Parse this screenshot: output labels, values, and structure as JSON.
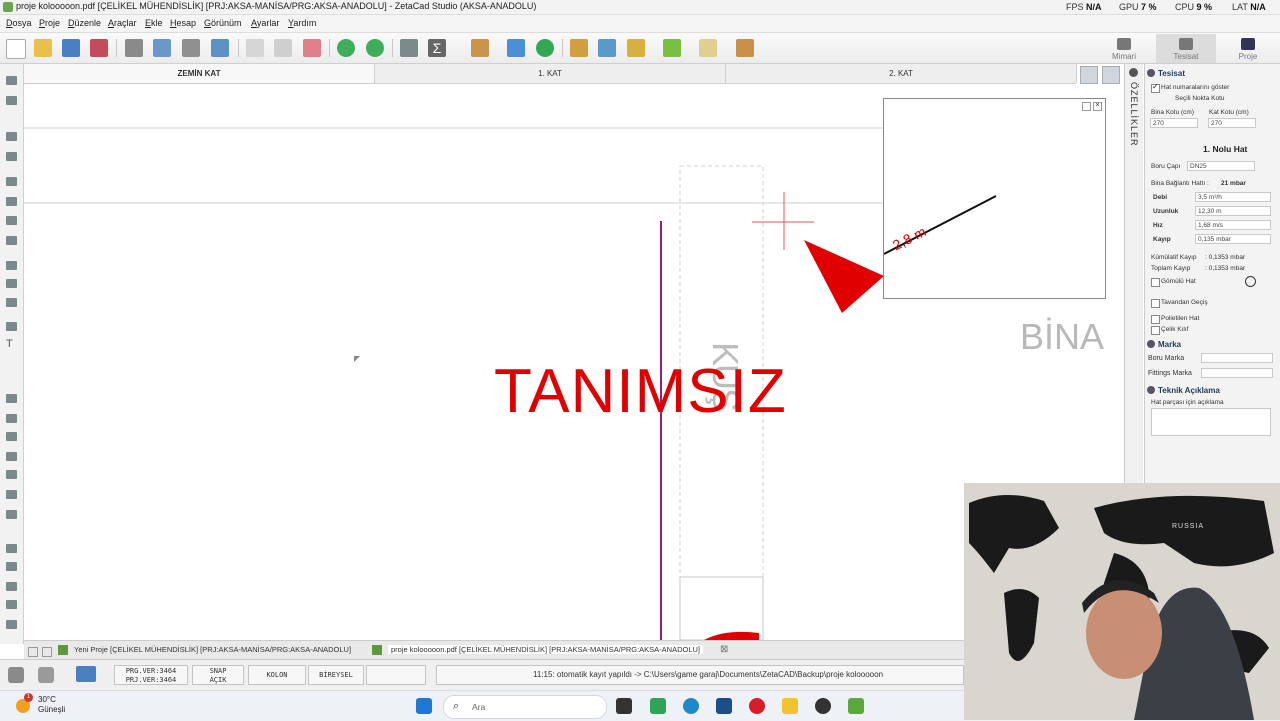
{
  "titlebar": {
    "title": "proje kolooooon.pdf  [ÇELİKEL MÜHENDİSLİK]  [PRJ:AKSA-MANİSA/PRG:AKSA-ANADOLU]  - ZetaCad Studio (AKSA-ANADOLU)",
    "fps_label": "FPS",
    "fps_value": "N/A",
    "gpu_label": "GPU",
    "gpu_value": "7 %",
    "cpu_label": "CPU",
    "cpu_value": "9 %",
    "lat_label": "LAT",
    "lat_value": "N/A"
  },
  "menu": [
    "Dosya",
    "Proje",
    "Düzenle",
    "Araçlar",
    "Ekle",
    "Hesap",
    "Görünüm",
    "Ayarlar",
    "Yardım"
  ],
  "modes": {
    "mimari": "Mimari",
    "tesisat": "Tesisat",
    "proje": "Proje"
  },
  "tabs": [
    "ZEMİN KAT",
    "1. KAT",
    "2. KAT"
  ],
  "canvas": {
    "big_label": "TANIMSIZ",
    "room_vertical": "KUŞ",
    "building_label": "BİNA",
    "pipe_length": "2,8 m"
  },
  "side_tab": "ÖZELLİKLER",
  "props": {
    "tesisat": {
      "header": "Tesisat",
      "show_line_numbers": "Hat numaralarını göster",
      "selected_point": "Seçili Nokta Kotu",
      "bina_kotu_label": "Bina Kotu (cm)",
      "bina_kotu_value": "270",
      "kat_kotu_label": "Kat Kotu (cm)",
      "kat_kotu_value": "270",
      "line_title": "1. Nolu Hat",
      "boru_capi_label": "Boru Çapı",
      "boru_capi_value": "DN25",
      "baglanti_label": "Bina Bağlantı Hattı :",
      "baglanti_value": "21 mbar",
      "rows": [
        {
          "label": "Debi",
          "value": "3,5 m³/h"
        },
        {
          "label": "Uzunluk",
          "value": "12,30 m"
        },
        {
          "label": "Hız",
          "value": "1,68 m/s"
        },
        {
          "label": "Kayıp",
          "value": "0,135 mbar"
        }
      ],
      "kumulatif_label": "Kümülatif Kayıp",
      "kumulatif_value": ": 0,1353 mbar",
      "toplam_label": "Toplam Kayıp",
      "toplam_value": ": 0,1353 mbar",
      "gomulu": "Gömülü Hat",
      "tavandan": "Tavandan Geçiş",
      "polietilen": "Polietilen Hat",
      "celik": "Çelik Kılıf"
    },
    "marka": {
      "header": "Marka",
      "boru_marka": "Boru Marka",
      "fittings_marka": "Fittings Marka"
    },
    "teknik": {
      "header": "Teknik Açıklama",
      "desc_label": "Hat parçası için açıklama"
    }
  },
  "doctabs": [
    "Yeni Proje  [ÇELİKEL MÜHENDİSLİK]  [PRJ:AKSA-MANİSA/PRG:AKSA-ANADOLU]",
    "proje kolooooon.pdf  [ÇELİKEL MÜHENDİSLİK]  [PRJ:AKSA-MANİSA/PRG:AKSA-ANADOLU]"
  ],
  "status": {
    "prg_ver": "PRG.VER:3464",
    "prj_ver": "PRJ.VER:3464",
    "snap": "SNAP",
    "snap_state": "AÇIK",
    "kolon": "KOLON",
    "bireysel": "BİREYSEL",
    "message": "11:15: otomatik kayıt yapıldı -> C:\\Users\\game garaj\\Documents\\ZetaCAD\\Backup\\proje kolooooon"
  },
  "taskbar": {
    "weather_temp": "30°C",
    "weather_desc": "Güneşli",
    "search_placeholder": "Ara",
    "notification_count": "1"
  },
  "webcam": {
    "map_text_russia": "RUSSIA"
  }
}
